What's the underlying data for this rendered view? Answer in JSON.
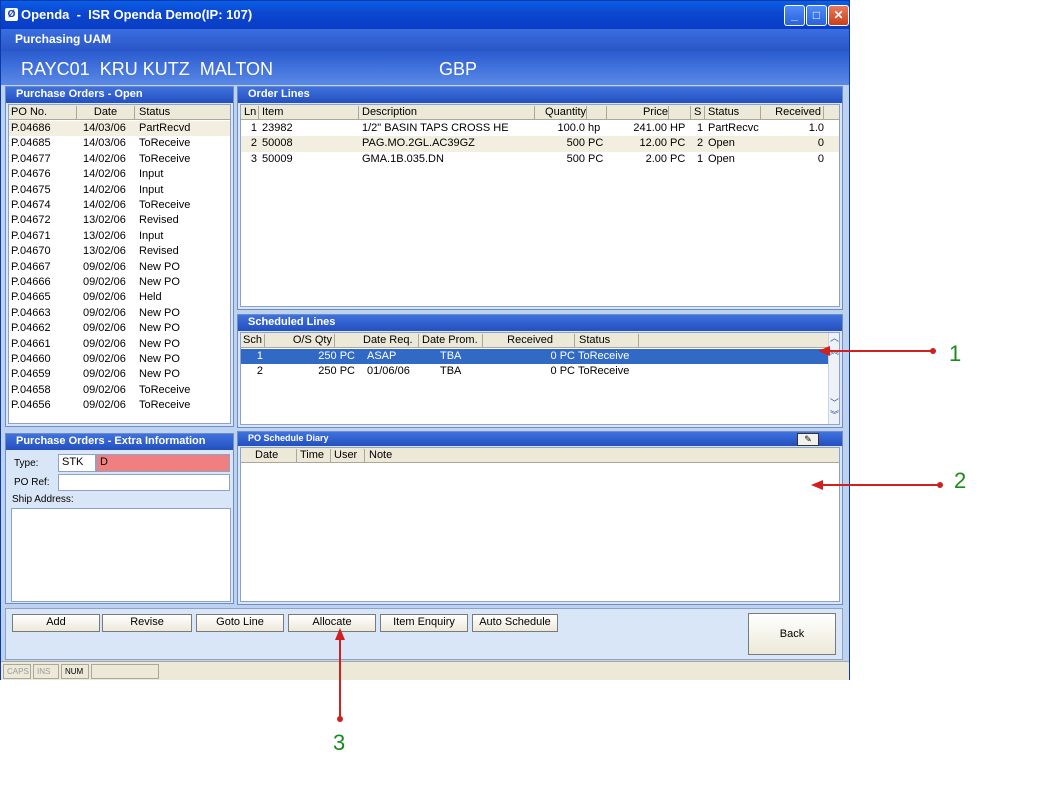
{
  "window": {
    "title": "Openda  -  ISR Openda Demo(IP: 107)",
    "app_icon_glyph": "Ø",
    "module": "Purchasing UAM"
  },
  "header": {
    "supplier": "RAYC01  KRU KUTZ  MALTON",
    "currency": "GBP"
  },
  "po_open": {
    "title": "Purchase Orders - Open",
    "columns": [
      "PO No.",
      "Date",
      "Status"
    ],
    "rows": [
      [
        "P.04686",
        "14/03/06",
        "PartRecvd"
      ],
      [
        "P.04685",
        "14/03/06",
        "ToReceive"
      ],
      [
        "P.04677",
        "14/02/06",
        "ToReceive"
      ],
      [
        "P.04676",
        "14/02/06",
        "Input"
      ],
      [
        "P.04675",
        "14/02/06",
        "Input"
      ],
      [
        "P.04674",
        "14/02/06",
        "ToReceive"
      ],
      [
        "P.04672",
        "13/02/06",
        "Revised"
      ],
      [
        "P.04671",
        "13/02/06",
        "Input"
      ],
      [
        "P.04670",
        "13/02/06",
        "Revised"
      ],
      [
        "P.04667",
        "09/02/06",
        "New PO"
      ],
      [
        "P.04666",
        "09/02/06",
        "New PO"
      ],
      [
        "P.04665",
        "09/02/06",
        "Held"
      ],
      [
        "P.04663",
        "09/02/06",
        "New PO"
      ],
      [
        "P.04662",
        "09/02/06",
        "New PO"
      ],
      [
        "P.04661",
        "09/02/06",
        "New PO"
      ],
      [
        "P.04660",
        "09/02/06",
        "New PO"
      ],
      [
        "P.04659",
        "09/02/06",
        "New PO"
      ],
      [
        "P.04658",
        "09/02/06",
        "ToReceive"
      ],
      [
        "P.04656",
        "09/02/06",
        "ToReceive"
      ]
    ]
  },
  "order_lines": {
    "title": "Order Lines",
    "columns": [
      "Ln",
      "Item",
      "Description",
      "Quantity",
      "Price",
      "S",
      "Status",
      "Received"
    ],
    "rows": [
      {
        "ln": "1",
        "item": "23982",
        "desc": "1/2\" BASIN TAPS CROSS HE",
        "qty": "100.0",
        "qty_unit": "hp",
        "price": "241.00",
        "price_unit": "HP",
        "s": "1",
        "status": "PartRecvc",
        "received": "1.0"
      },
      {
        "ln": "2",
        "item": "50008",
        "desc": "PAG.MO.2GL.AC39GZ",
        "qty": "500",
        "qty_unit": "PC",
        "price": "12.00",
        "price_unit": "PC",
        "s": "2",
        "status": "Open",
        "received": "0"
      },
      {
        "ln": "3",
        "item": "50009",
        "desc": "GMA.1B.035.DN",
        "qty": "500",
        "qty_unit": "PC",
        "price": "2.00",
        "price_unit": "PC",
        "s": "1",
        "status": "Open",
        "received": "0"
      }
    ]
  },
  "scheduled_lines": {
    "title": "Scheduled Lines",
    "columns": [
      "Sch",
      "O/S Qty",
      "Date Req.",
      "Date Prom.",
      "Received",
      "Status"
    ],
    "rows": [
      {
        "sch": "1",
        "qty": "250 PC",
        "date_req": "ASAP",
        "date_prom": "TBA",
        "received": "0 PC",
        "status": "ToReceive"
      },
      {
        "sch": "2",
        "qty": "250 PC",
        "date_req": "01/06/06",
        "date_prom": "TBA",
        "received": "0 PC",
        "status": "ToReceive"
      }
    ],
    "selected_row": 0
  },
  "extra_info": {
    "title": "Purchase Orders - Extra Information",
    "type_label": "Type:",
    "type_code": "STK",
    "type_flag": "D",
    "poref_label": "PO Ref:",
    "poref_value": "",
    "ship_label": "Ship Address:"
  },
  "diary": {
    "title": "PO Schedule Diary",
    "columns": [
      "Date",
      "Time",
      "User",
      "Note"
    ]
  },
  "actions": {
    "add": "Add",
    "revise": "Revise",
    "goto_line": "Goto Line",
    "allocate": "Allocate",
    "item_enquiry": "Item Enquiry",
    "auto_schedule": "Auto Schedule",
    "back": "Back"
  },
  "status_bar": [
    "CAPS",
    "INS",
    "NUM"
  ],
  "annotations": [
    "1",
    "2",
    "3"
  ],
  "colors": {
    "title_blue": "#0a46cf",
    "selection": "#316ac5",
    "annotation_arrow": "#d02020",
    "annotation_text": "#1a8a1a",
    "type_flag_bg": "#f08080"
  }
}
